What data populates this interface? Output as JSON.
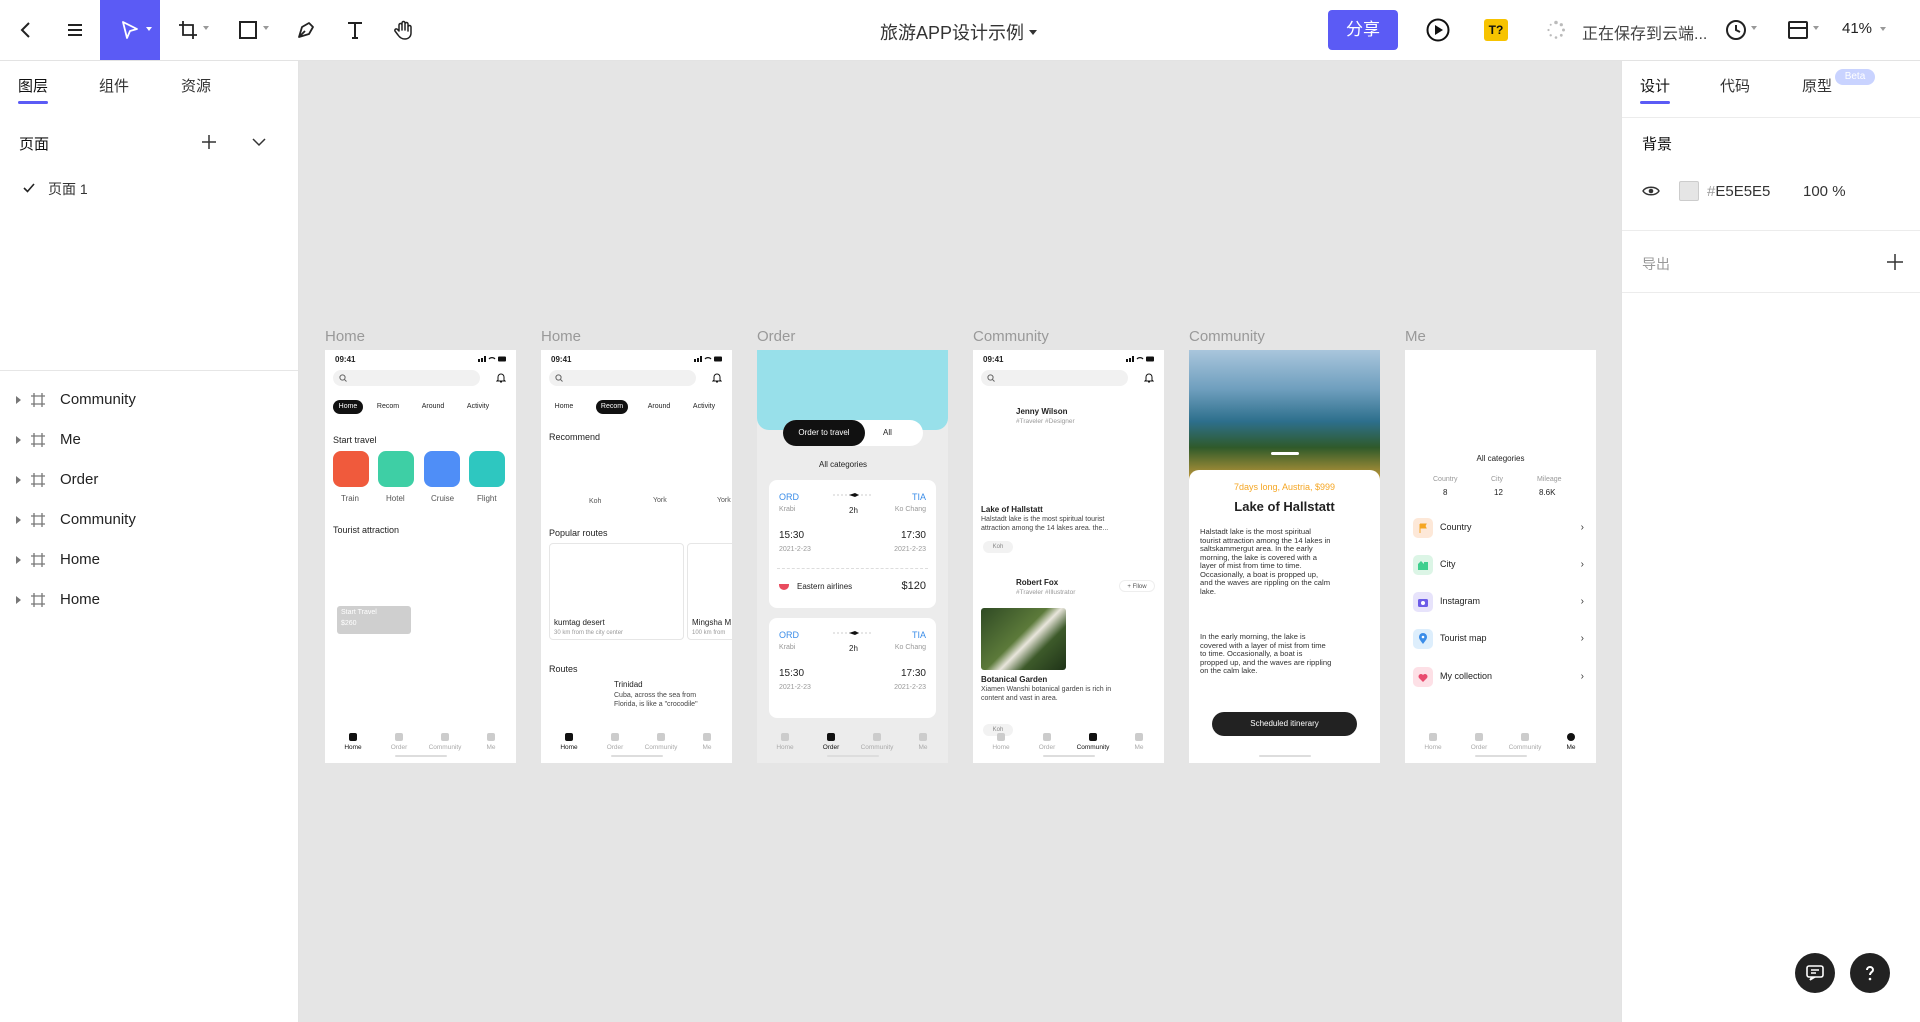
{
  "toolbar": {
    "title": "旅游APP设计示例",
    "share_label": "分享",
    "font_badge": "T?",
    "saving_status": "正在保存到云端...",
    "zoom": "41%",
    "accent": "#5b5bf5"
  },
  "left_panel": {
    "tabs": [
      {
        "label": "图层",
        "active": true
      },
      {
        "label": "组件",
        "active": false
      },
      {
        "label": "资源",
        "active": false
      }
    ],
    "pages_title": "页面",
    "pages": [
      {
        "label": "页面 1",
        "selected": true
      }
    ],
    "layers": [
      {
        "label": "Community"
      },
      {
        "label": "Me"
      },
      {
        "label": "Order"
      },
      {
        "label": "Community"
      },
      {
        "label": "Home"
      },
      {
        "label": "Home"
      }
    ]
  },
  "right_panel": {
    "tabs": [
      {
        "label": "设计",
        "active": true
      },
      {
        "label": "代码",
        "active": false
      },
      {
        "label": "原型",
        "active": false
      }
    ],
    "beta_badge": "Beta",
    "background_title": "背景",
    "background_color": "E5E5E5",
    "background_hash": "#",
    "opacity": "100 %",
    "export_title": "导出"
  },
  "frames": [
    {
      "name": "Home",
      "time": "09:41",
      "filters": [
        "Home",
        "Recom",
        "Around",
        "Activity"
      ],
      "section_title": "Start travel",
      "categories": [
        {
          "label": "Train",
          "color": "#f05a3c"
        },
        {
          "label": "Hotel",
          "color": "#3ecfa5"
        },
        {
          "label": "Cruise",
          "color": "#4f8ef7"
        },
        {
          "label": "Flight",
          "color": "#2ec7c0"
        }
      ],
      "section2_title": "Tourist attraction",
      "card_title": "Start Travel",
      "card_price": "$260",
      "nav": [
        "Home",
        "Order",
        "Community",
        "Me"
      ]
    },
    {
      "name": "Home",
      "time": "09:41",
      "filters": [
        "Home",
        "Recom",
        "Around",
        "Activity"
      ],
      "recommend_title": "Recommend",
      "recommend_labels": [
        "Koh",
        "York",
        "York"
      ],
      "popular_title": "Popular routes",
      "route_cards": [
        {
          "name": "kumtag desert",
          "sub": "30 km from the city center"
        },
        {
          "name": "Mingsha M",
          "sub": "100 km from"
        }
      ],
      "routes_title": "Routes",
      "route_name": "Trinidad",
      "route_desc_1": "Cuba, across the sea from",
      "route_desc_2": "Florida, is like a \"crocodile\"",
      "nav": [
        "Home",
        "Order",
        "Community",
        "Me"
      ]
    },
    {
      "name": "Order",
      "toggle": [
        "Order to travel",
        "All"
      ],
      "category_select": "All categories",
      "tickets": [
        {
          "from": "ORD",
          "to": "TIA",
          "from_city": "Krabi",
          "to_city": "Ko Chang",
          "duration": "2h",
          "dep": "15:30",
          "arr": "17:30",
          "dep_date": "2021-2-23",
          "arr_date": "2021-2-23",
          "airline": "Eastern airlines",
          "price": "$120"
        },
        {
          "from": "ORD",
          "to": "TIA",
          "from_city": "Krabi",
          "to_city": "Ko Chang",
          "duration": "2h",
          "dep": "15:30",
          "arr": "17:30",
          "dep_date": "2021-2-23",
          "arr_date": "2021-2-23"
        }
      ],
      "nav": [
        "Home",
        "Order",
        "Community",
        "Me"
      ]
    },
    {
      "name": "Community",
      "time": "09:41",
      "user1": "Jenny Wilson",
      "user1_tags": "#Traveler  #Designer",
      "post1_title": "Lake of Hallstatt",
      "post1_text_1": "Halstadt lake is the most spiritual tourist",
      "post1_text_2": "attraction among the 14 lakes  area. the...",
      "post1_tag": "Koh",
      "user2": "Robert Fox",
      "user2_tags": "#Traveler  #Illustrator",
      "follow_label": "+ Fllow",
      "post2_title": "Botanical Garden",
      "post2_text_1": "Xiamen Wanshi botanical garden is rich in",
      "post2_text_2": "content and vast in area.",
      "post2_tag": "Koh",
      "nav": [
        "Home",
        "Order",
        "Community",
        "Me"
      ]
    },
    {
      "name": "Community",
      "promo": "7days long, Austria, $999",
      "title": "Lake of Hallstatt",
      "para1": [
        "Halstadt lake is the most spiritual",
        "tourist attraction among the 14 lakes in",
        "saltskammergut area. In the early",
        "morning, the lake is covered with a",
        "layer of mist from time to time.",
        "Occasionally, a boat is propped up,",
        "and the waves are rippling on the calm",
        "lake."
      ],
      "para2": [
        "In the early morning, the lake is",
        "covered with a layer of mist from time",
        "to time. Occasionally, a boat is",
        "propped up, and the waves are rippling",
        "on the calm lake."
      ],
      "button": "Scheduled itinerary"
    },
    {
      "name": "Me",
      "section_title": "All categories",
      "stats": [
        {
          "label": "Country",
          "value": "8"
        },
        {
          "label": "City",
          "value": "12"
        },
        {
          "label": "Mileage",
          "value": "8.6K"
        }
      ],
      "rows": [
        {
          "label": "Country",
          "color": "#fde8d8"
        },
        {
          "label": "City",
          "color": "#dcf5e6"
        },
        {
          "label": "Instagram",
          "color": "#e7e3fb"
        },
        {
          "label": "Tourist map",
          "color": "#ddeefc"
        },
        {
          "label": "My collection",
          "color": "#fde0e6"
        }
      ],
      "nav": [
        "Home",
        "Order",
        "Community",
        "Me"
      ]
    }
  ]
}
